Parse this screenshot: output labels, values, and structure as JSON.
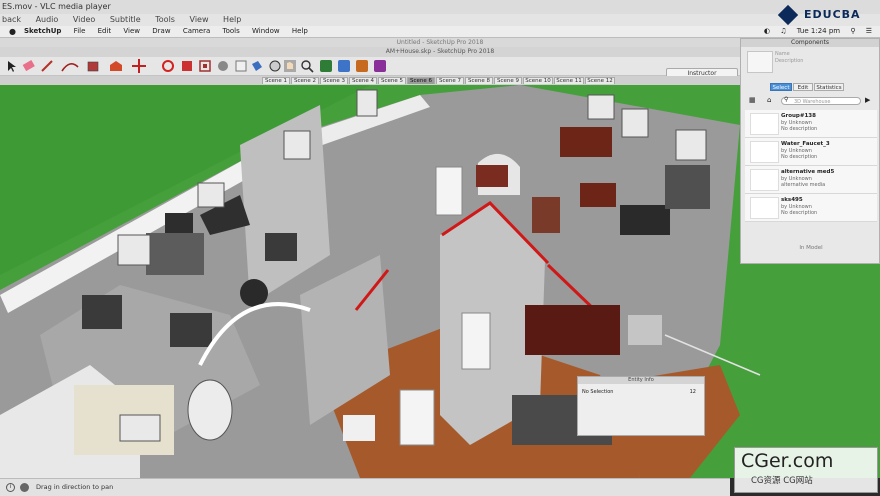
{
  "vlc": {
    "title": "ES.mov - VLC media player",
    "menu": [
      "back",
      "Audio",
      "Video",
      "Subtitle",
      "Tools",
      "View",
      "Help"
    ]
  },
  "brand": {
    "logo_text": "EDUCBA",
    "logo_color": "#0b2a5a"
  },
  "mac_menu": {
    "app_name": "SketchUp",
    "items": [
      "File",
      "Edit",
      "View",
      "Draw",
      "Camera",
      "Tools",
      "Window",
      "Help"
    ],
    "clock": "Tue 1:24 pm"
  },
  "documents": {
    "untitled": "Untitled - SketchUp Pro 2018",
    "current": "AM+House.skp - SketchUp Pro 2018"
  },
  "toolbar": {
    "tools": [
      "select-tool",
      "eraser-tool",
      "line-tool",
      "arc-tool",
      "rectangle-tool",
      "push-pull-tool",
      "move-tool",
      "rotate-tool",
      "scale-tool",
      "offset-tool",
      "tape-measure-tool",
      "text-tool",
      "paint-bucket-tool",
      "orbit-tool",
      "pan-tool",
      "zoom-tool",
      "zoom-extents-tool",
      "previous-view-tool",
      "warehouse-tool",
      "extension-tool"
    ],
    "instructor_label": "Instructor"
  },
  "scenes": [
    "Scene 1",
    "Scene 2",
    "Scene 3",
    "Scene 4",
    "Scene 5",
    "Scene 6",
    "Scene 7",
    "Scene 8",
    "Scene 9",
    "Scene 10",
    "Scene 11",
    "Scene 12"
  ],
  "active_scene_index": 5,
  "components": {
    "title": "Components",
    "preview_name": "Name",
    "preview_desc": "Description",
    "tabs": [
      "Select",
      "Edit",
      "Statistics"
    ],
    "active_tab": 0,
    "search_placeholder": "3D Warehouse",
    "items": [
      {
        "name": "Group#138",
        "by": "by Unknown",
        "desc": "No description"
      },
      {
        "name": "Water_Faucet_3",
        "by": "by Unknown",
        "desc": "No description"
      },
      {
        "name": "alternative med5",
        "by": "by Unknown",
        "desc": "alternative media"
      },
      {
        "name": "sks495",
        "by": "by Unknown",
        "desc": "No description"
      }
    ],
    "footer": "In Model"
  },
  "entity_info": {
    "title": "Entity Info",
    "selection": "No Selection",
    "count": "12"
  },
  "status": {
    "hint": "Drag in direction to pan"
  },
  "watermark": {
    "big": "CGer.com",
    "small": "CG资源 CG网站"
  },
  "colors": {
    "grass": "#3d9a35",
    "floor_wood": "#a65a2c",
    "wall": "#c8c8c8",
    "selection_red": "#d01818",
    "accent_blue": "#4a8fd6"
  }
}
